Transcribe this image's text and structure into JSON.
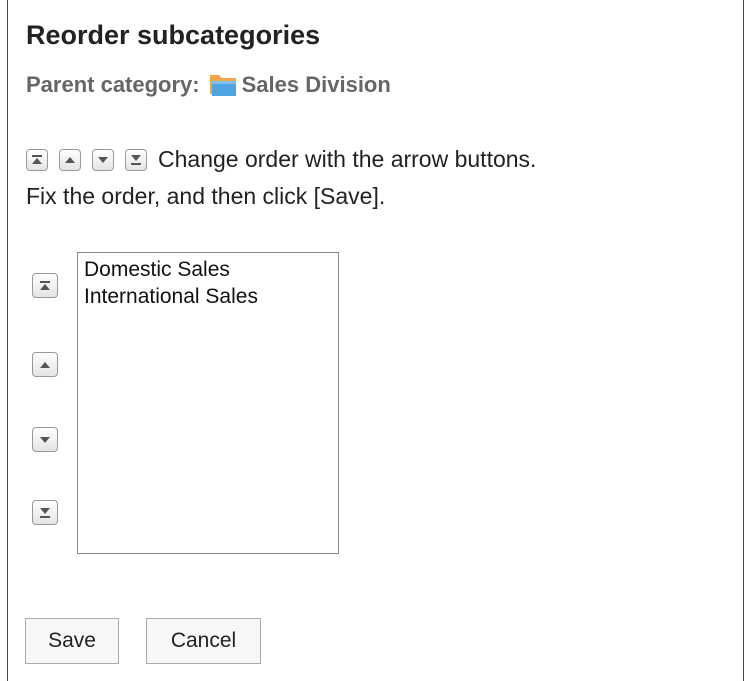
{
  "page": {
    "title": "Reorder subcategories",
    "parent_label": "Parent category:",
    "parent_name": "Sales Division",
    "instruction_line1": "Change order with the arrow buttons.",
    "instruction_line2": "Fix the order, and then click [Save]."
  },
  "subcategories": [
    "Domestic Sales",
    "International Sales"
  ],
  "buttons": {
    "save": "Save",
    "cancel": "Cancel"
  },
  "icons": {
    "folder": "folder-icon",
    "top": "move-to-top-icon",
    "up": "move-up-icon",
    "down": "move-down-icon",
    "bottom": "move-to-bottom-icon"
  },
  "colors": {
    "folder_front": "#4ea3e0",
    "folder_back": "#f0a64a",
    "arrow": "#555555"
  }
}
